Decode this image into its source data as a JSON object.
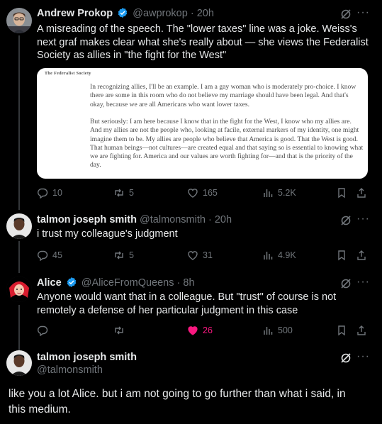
{
  "tweets": [
    {
      "name": "Andrew Prokop",
      "handle": "@awprokop",
      "time": "20h",
      "text": "A misreading of the speech. The \"lower taxes\" line was a joke. Weiss's next graf makes clear what she's really about — she views the Federalist Society as allies in \"the fight for the West\"",
      "quote": {
        "source": "The Federalist Society",
        "p1": "In recognizing allies, I'll be an example. I am a gay woman who is moderately pro-choice. I know there are some in this room who do not believe my marriage should have been legal. And that's okay, because we are all Americans who want lower taxes.",
        "p2": "But seriously: I am here because I know that in the fight for the West, I know who my allies are. And my allies are not the people who, looking at facile, external markers of my identity, one might imagine them to be. My allies are people who believe that America is good. That the West is good. That human beings—not cultures—are created equal and that saying so is essential to knowing what we are fighting for. America and our values are worth fighting for—and that is the priority of the day."
      },
      "replies": "10",
      "reposts": "5",
      "likes": "165",
      "views": "5.2K"
    },
    {
      "name": "talmon joseph smith",
      "handle": "@talmonsmith",
      "time": "20h",
      "text": "i trust my colleague's judgment",
      "replies": "45",
      "reposts": "5",
      "likes": "31",
      "views": "4.9K"
    },
    {
      "name": "Alice",
      "handle": "@AliceFromQueens",
      "time": "8h",
      "text": "Anyone would want that in a colleague. But \"trust\" of course is not remotely a defense of her particular judgment in this case",
      "replies": "",
      "reposts": "",
      "likes": "26",
      "views": "500"
    }
  ],
  "main_tweet": {
    "name": "talmon joseph smith",
    "handle": "@talmonsmith",
    "text": "like you a lot Alice. but i am not going to go further than what i said, in this medium."
  },
  "icons": {
    "more": "more-icon",
    "grok": "grok-icon",
    "verified": "verified-badge-icon"
  },
  "colors": {
    "background": "#000000",
    "text": "#e7e9ea",
    "muted": "#71767b",
    "like_active": "#f91880",
    "verified": "#1d9bf0"
  },
  "separator": "·"
}
